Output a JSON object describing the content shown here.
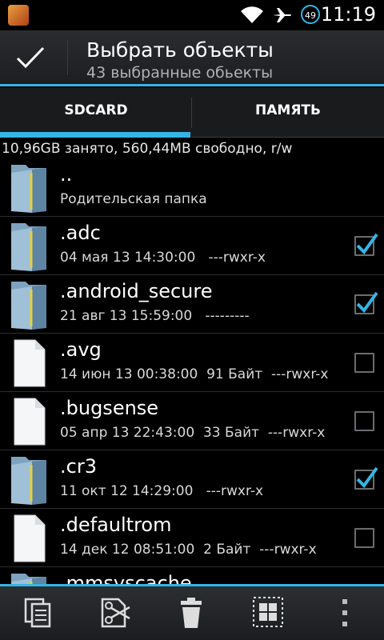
{
  "status": {
    "time": "11:19",
    "battery": "49"
  },
  "action_bar": {
    "title": "Выбрать объекты",
    "subtitle": "43 выбранные обьекты"
  },
  "tabs": [
    {
      "label": "SDCARD"
    },
    {
      "label": "ПАМЯТЬ"
    }
  ],
  "storage_info": "10,96GB занято, 560,44MB свободно, r/w",
  "files": [
    {
      "name": "..",
      "meta": "Родительская папка",
      "type": "folder",
      "checked": null
    },
    {
      "name": ".adc",
      "meta": "04 мая 13 14:30:00   ---rwxr-x",
      "type": "folder",
      "checked": true
    },
    {
      "name": ".android_secure",
      "meta": "21 авг 13 15:59:00   ---------",
      "type": "folder",
      "checked": true
    },
    {
      "name": ".avg",
      "meta": "14 июн 13 00:38:00  91 Байт  ---rwxr-x",
      "type": "file",
      "checked": false
    },
    {
      "name": ".bugsense",
      "meta": "05 апр 13 22:43:00  33 Байт  ---rwxr-x",
      "type": "file",
      "checked": false
    },
    {
      "name": ".cr3",
      "meta": "11 окт 12 14:29:00   ---rwxr-x",
      "type": "folder",
      "checked": true
    },
    {
      "name": ".defaultrom",
      "meta": "14 дек 12 08:51:00  2 Байт  ---rwxr-x",
      "type": "file",
      "checked": false
    },
    {
      "name": ".mmsyscache",
      "meta": "",
      "type": "folder",
      "checked": null
    }
  ],
  "bottom_bar": [
    "copy-icon",
    "cut-icon",
    "delete-icon",
    "select-all-icon",
    "overflow-menu-icon"
  ],
  "colors": {
    "accent": "#33b5e5"
  }
}
